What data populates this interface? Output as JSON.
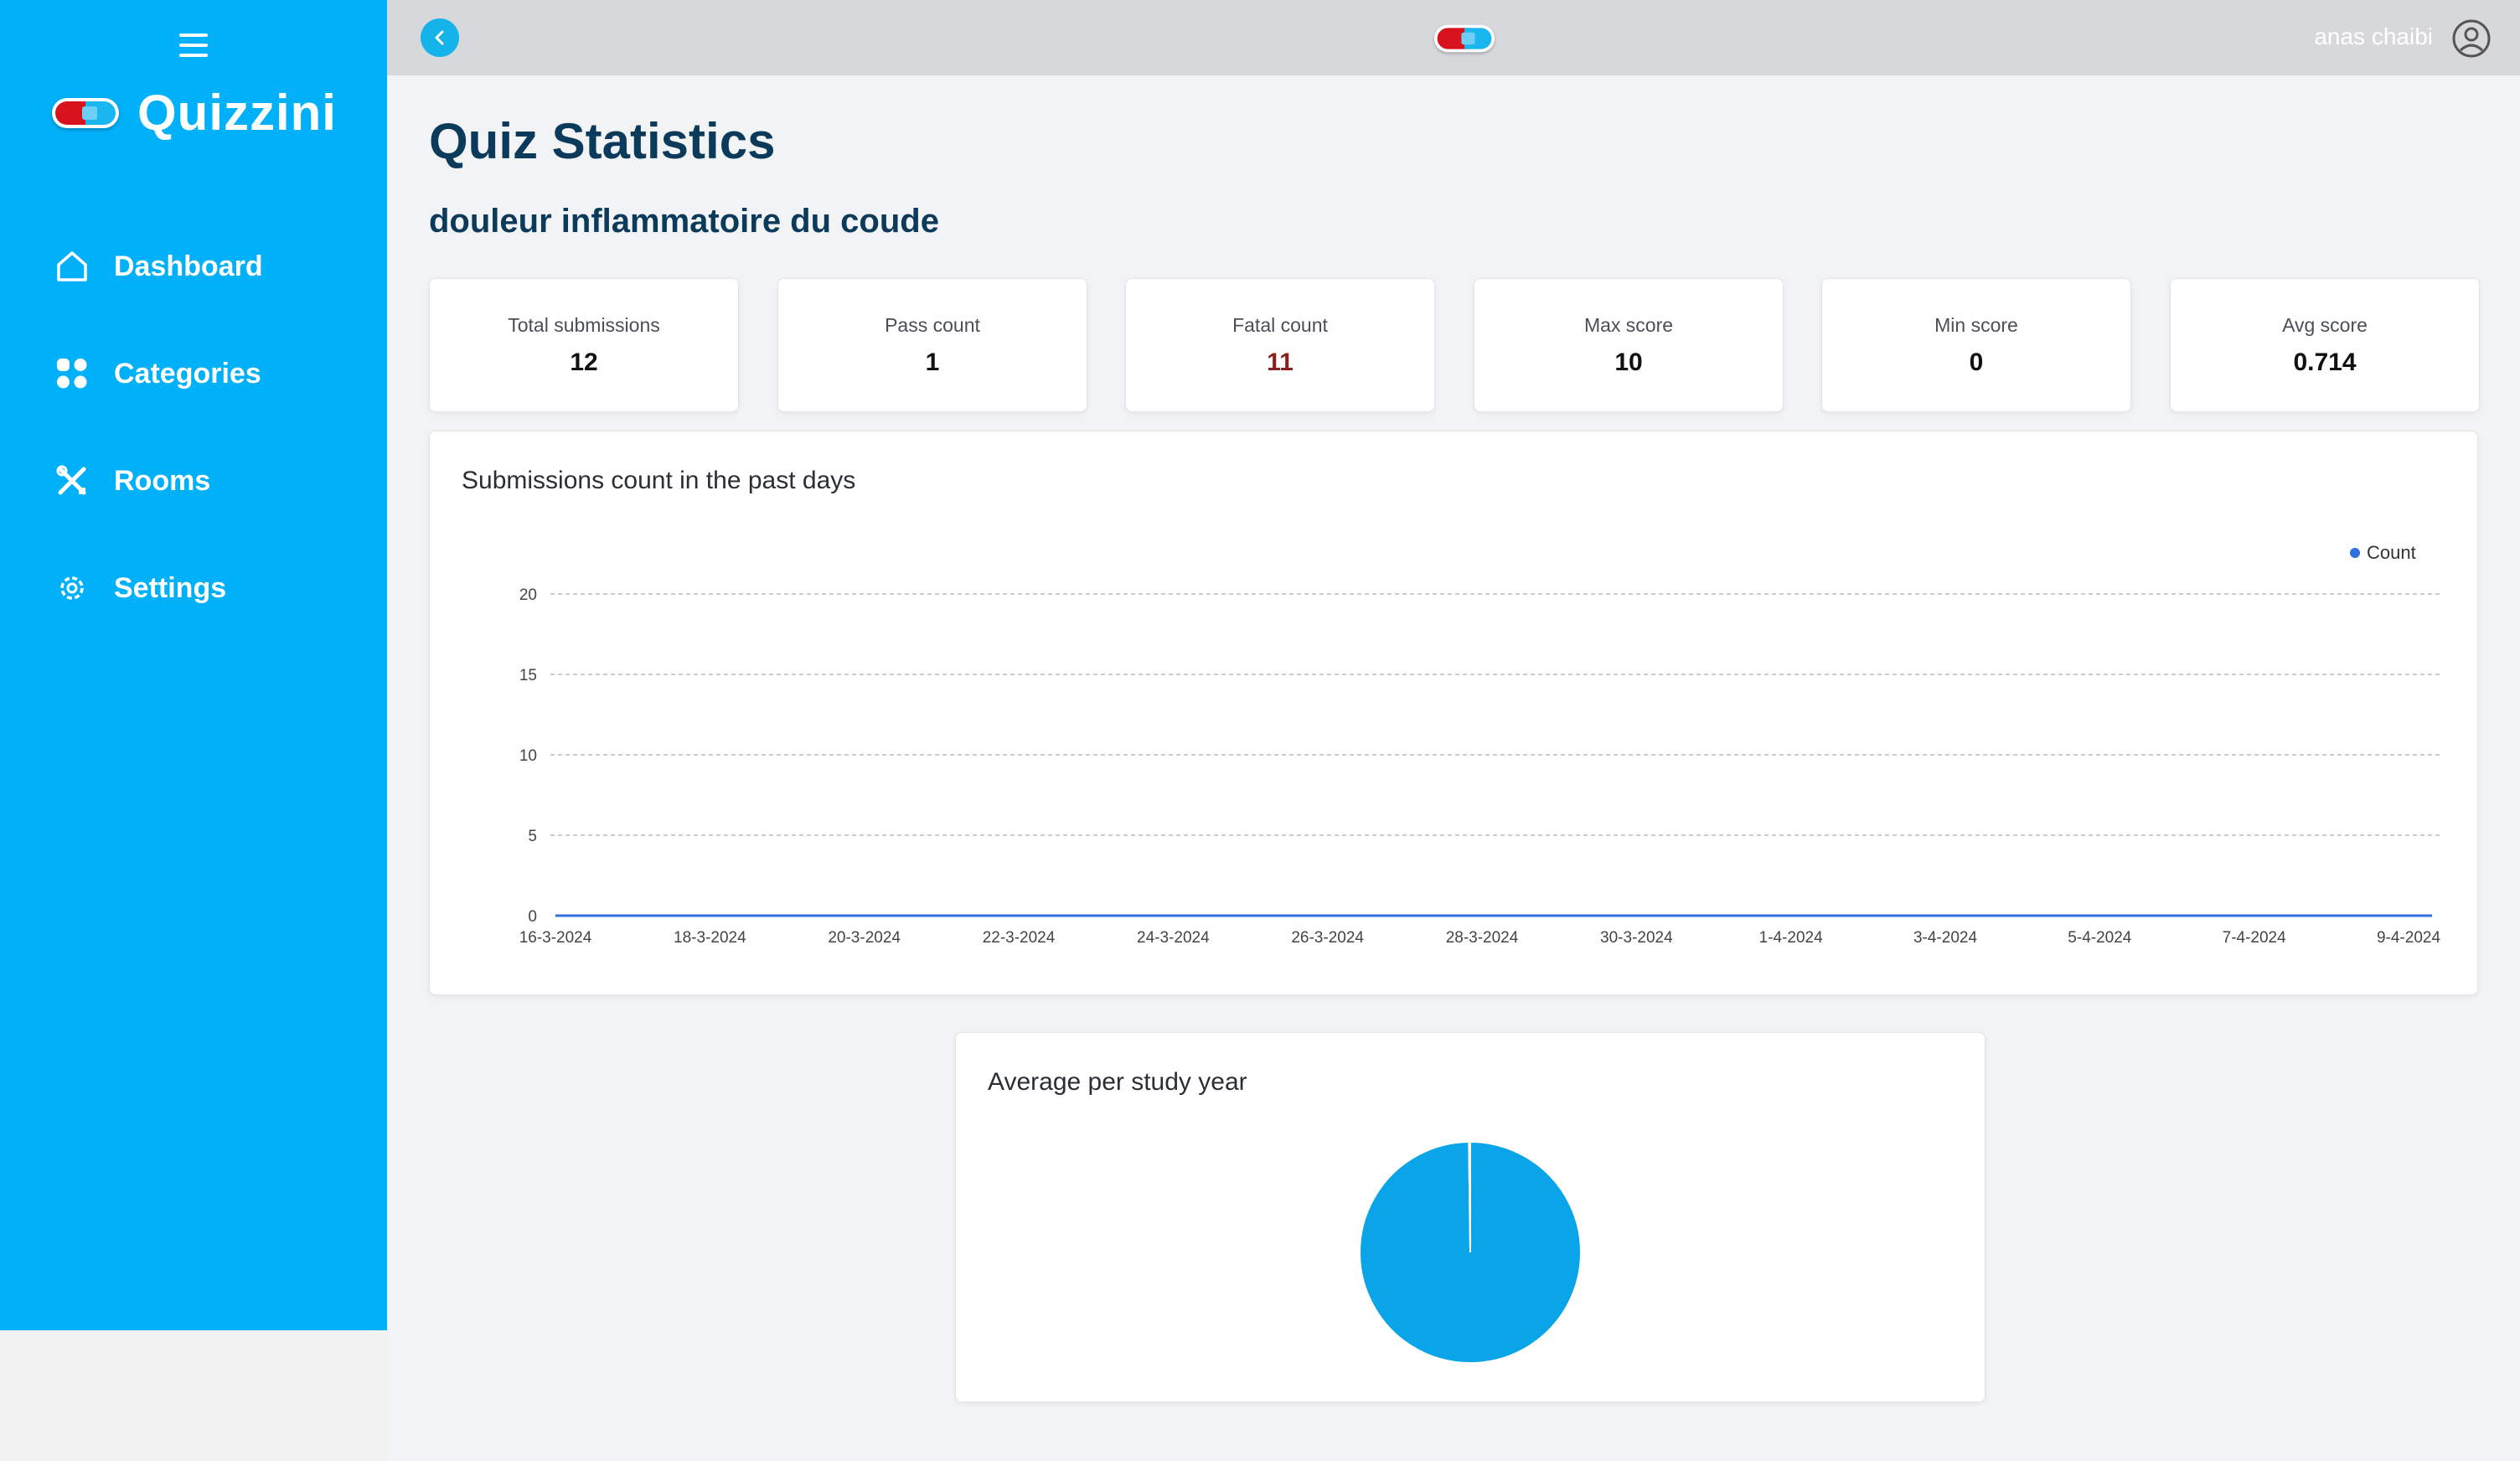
{
  "sidebar": {
    "brand": "Quizzini",
    "items": [
      {
        "label": "Dashboard",
        "icon": "home-icon"
      },
      {
        "label": "Categories",
        "icon": "grid-icon"
      },
      {
        "label": "Rooms",
        "icon": "tools-icon"
      },
      {
        "label": "Settings",
        "icon": "gear-icon"
      }
    ]
  },
  "topbar": {
    "user_name": "anas chaibi"
  },
  "page": {
    "title": "Quiz Statistics",
    "quiz_name": "douleur inflammatoire du coude"
  },
  "stats": [
    {
      "label": "Total submissions",
      "value": "12"
    },
    {
      "label": "Pass count",
      "value": "1"
    },
    {
      "label": "Fatal count",
      "value": "11"
    },
    {
      "label": "Max score",
      "value": "10"
    },
    {
      "label": "Min score",
      "value": "0"
    },
    {
      "label": "Avg score",
      "value": "0.714"
    }
  ],
  "colors": {
    "sidebar": "#00b0f9",
    "title": "#0b3a5a",
    "fatal": "#8a1f1f",
    "line": "#2f6fe0",
    "pie": "#0aa4e8"
  },
  "chart_data": [
    {
      "type": "line",
      "title": "Submissions count in the past days",
      "legend": [
        "Count"
      ],
      "legend_position": "top-right",
      "grid": true,
      "ylim": [
        0,
        20
      ],
      "yticks": [
        "0",
        "5",
        "10",
        "15",
        "20"
      ],
      "x_tick_labels": [
        "16-3-2024",
        "18-3-2024",
        "20-3-2024",
        "22-3-2024",
        "24-3-2024",
        "26-3-2024",
        "28-3-2024",
        "30-3-2024",
        "1-4-2024",
        "3-4-2024",
        "5-4-2024",
        "7-4-2024",
        "9-4-2024"
      ],
      "series": [
        {
          "name": "Count",
          "values": [
            0,
            0,
            0,
            0,
            0,
            0,
            0,
            0,
            0,
            0,
            0,
            0,
            0
          ]
        }
      ]
    },
    {
      "type": "pie",
      "title": "Average per study year",
      "slices": [
        {
          "value": 99.8
        },
        {
          "value": 0.2
        }
      ]
    }
  ]
}
